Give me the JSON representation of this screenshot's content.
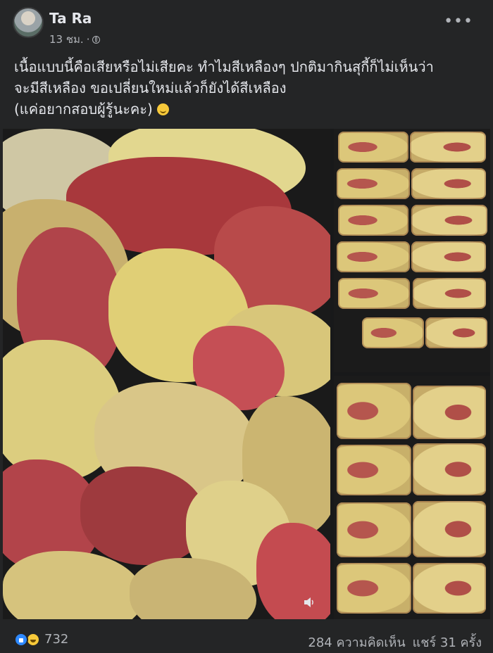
{
  "post": {
    "author": "Ta Ra",
    "time": "13 ชม.",
    "text_line1": "เนื้อแบบนี้คือเสียหรือไม่เสียคะ ทำไมสีเหลืองๆ ปกติมากินสุกี้ก็ไม่เห็นว่า",
    "text_line2": "จะมีสีเหลือง ขอเปลี่ยนใหม่แล้วก็ยังได้สีเหลือง",
    "text_line3": "(แค่อยากสอบผู้รู้นะคะ)",
    "more_label": "•••",
    "privacy_icon": "globe-icon",
    "emoji_icon": "grinning-emoji-icon"
  },
  "footer": {
    "reaction_count": "732",
    "comments": "284 ความคิดเห็น",
    "shares": "แชร์ 31 ครั้ง",
    "reaction_icons": [
      "like-icon",
      "haha-icon"
    ]
  },
  "colors": {
    "background": "#242526",
    "text": "#e4e6eb",
    "secondary_text": "#b0b3b8",
    "like_blue": "#2e89ff"
  }
}
